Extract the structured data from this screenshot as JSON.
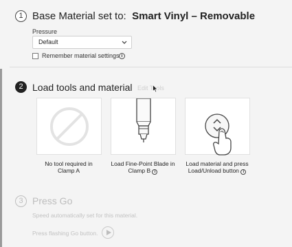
{
  "step1": {
    "number": "1",
    "title_prefix": "Base Material set to:",
    "material": "Smart Vinyl – Removable",
    "pressure_label": "Pressure",
    "pressure_value": "Default",
    "remember_label": "Remember material settings",
    "remember_checked": false
  },
  "step2": {
    "number": "2",
    "title": "Load tools and material",
    "edit_tools": "Edit Tools",
    "cards": [
      {
        "line1": "No tool required in",
        "line2": "Clamp A",
        "icon": "no-symbol-icon"
      },
      {
        "line1": "Load Fine-Point Blade in",
        "line2": "Clamp B",
        "icon": "fine-point-blade-icon"
      },
      {
        "line1": "Load material and press",
        "line2": "Load/Unload button",
        "icon": "load-unload-press-icon"
      }
    ]
  },
  "step3": {
    "number": "3",
    "title": "Press Go",
    "speed_text": "Speed automatically set for this material.",
    "go_text": "Press flashing Go button."
  },
  "colors": {
    "background": "#f4f4f4",
    "active_step": "#222222",
    "disabled_text": "#bdbdbd"
  }
}
